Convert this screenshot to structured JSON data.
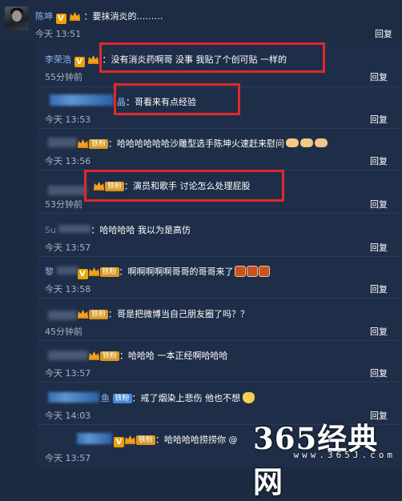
{
  "top_comment": {
    "name": "陈坤",
    "text": "：要抹消炎的………",
    "time": "今天 13:51",
    "reply": "回复"
  },
  "replies": [
    {
      "name": "李荣浩",
      "text": "：没有消炎药啊哥 没事 我贴了个创可贴 一样的",
      "time": "55分钟前",
      "reply": "回复"
    },
    {
      "name": "",
      "prefix": "晶",
      "text": "：哥看来有点经验",
      "time": "今天 13:53",
      "reply": "回复"
    },
    {
      "name": "",
      "badge": "铁粉",
      "text": "：哈哈哈哈哈哈沙雕型选手陈坤火速赶来慰问",
      "time": "今天 13:56",
      "reply": "回复"
    },
    {
      "name": "",
      "badge": "铁粉",
      "text": "：演员和歌手 讨论怎么处理屁股",
      "time": "53分钟前",
      "reply": "回复"
    },
    {
      "name": "Su",
      "text": "：哈哈哈哈 我以为是高仿",
      "time": "今天 13:57",
      "reply": "回复"
    },
    {
      "name": "黎",
      "badge": "铁粉",
      "text": "：啊啊啊啊啊哥哥的哥哥来了",
      "time": "今天 13:58",
      "reply": "回复"
    },
    {
      "name": "",
      "badge": "铁粉",
      "text": "：哥是把微博当自己朋友圈了吗？？",
      "time": "45分钟前",
      "reply": "回复"
    },
    {
      "name": "",
      "badge": "铁粉",
      "text": "：哈哈哈  一本正经啊哈哈哈",
      "time": "今天 13:57",
      "reply": "回复"
    },
    {
      "name": "",
      "suffix": "鱼",
      "badge": "铁粉",
      "text": "：戒了烟染上悲伤 他也不想",
      "time": "今天 14:03",
      "reply": "回复"
    },
    {
      "name": "",
      "badge": "铁粉",
      "text": "：哈哈哈哈捞捞你 @",
      "time": "今天 13:57",
      "reply": "回复"
    }
  ],
  "watermark": {
    "main": "365经典网",
    "sub": "www.365J.com"
  },
  "colors": {
    "name": "#8fb6ec",
    "highlight_box": "#e0282a",
    "background": "#1c2a42"
  }
}
